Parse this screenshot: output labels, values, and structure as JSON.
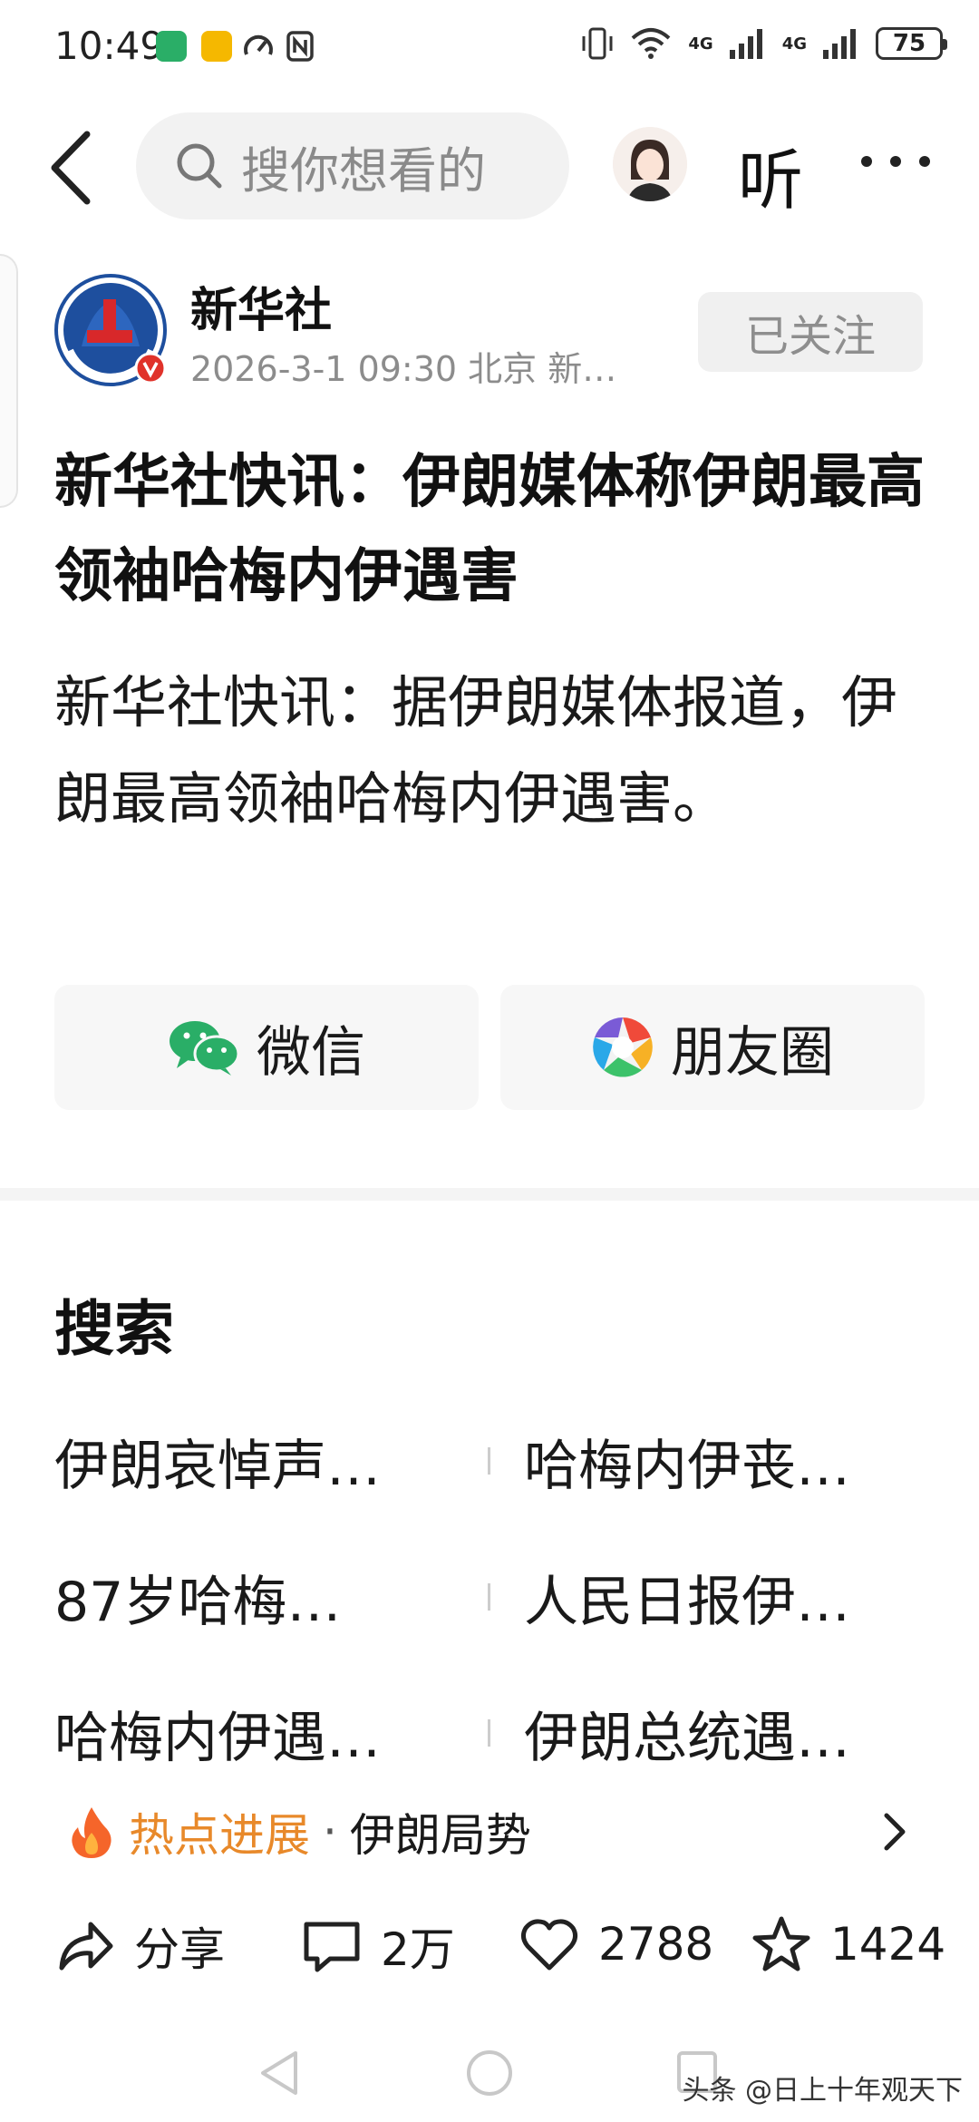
{
  "status_bar": {
    "time": "10:49",
    "network_1": "4G",
    "network_2": "4G",
    "battery": "75"
  },
  "top_nav": {
    "search_placeholder": "搜你想看的",
    "listen_label": "听"
  },
  "author": {
    "name": "新华社",
    "meta": "2026-3-1 09:30 北京 新…",
    "follow_label": "已关注"
  },
  "article": {
    "title": "新华社快讯：伊朗媒体称伊朗最高领袖哈梅内伊遇害",
    "body": "新华社快讯：据伊朗媒体报道，伊朗最高领袖哈梅内伊遇害。"
  },
  "share": {
    "wechat_label": "微信",
    "moments_label": "朋友圈"
  },
  "search_section": {
    "heading": "搜索",
    "items": [
      [
        "伊朗哀悼声…",
        "哈梅内伊丧…"
      ],
      [
        "87岁哈梅…",
        "人民日报伊…"
      ],
      [
        "哈梅内伊遇…",
        "伊朗总统遇…"
      ]
    ]
  },
  "hot": {
    "label": "热点进展",
    "separator": "·",
    "topic": "伊朗局势"
  },
  "actions": {
    "share_label": "分享",
    "comments": "2万",
    "likes": "2788",
    "favorites": "1424"
  },
  "watermark": "头条 @日上十年观天下",
  "colors": {
    "hot_orange": "#e8892a",
    "wechat_green": "#2aae67",
    "xinhua_blue": "#1e4f9e",
    "badge_red": "#e0322a"
  }
}
